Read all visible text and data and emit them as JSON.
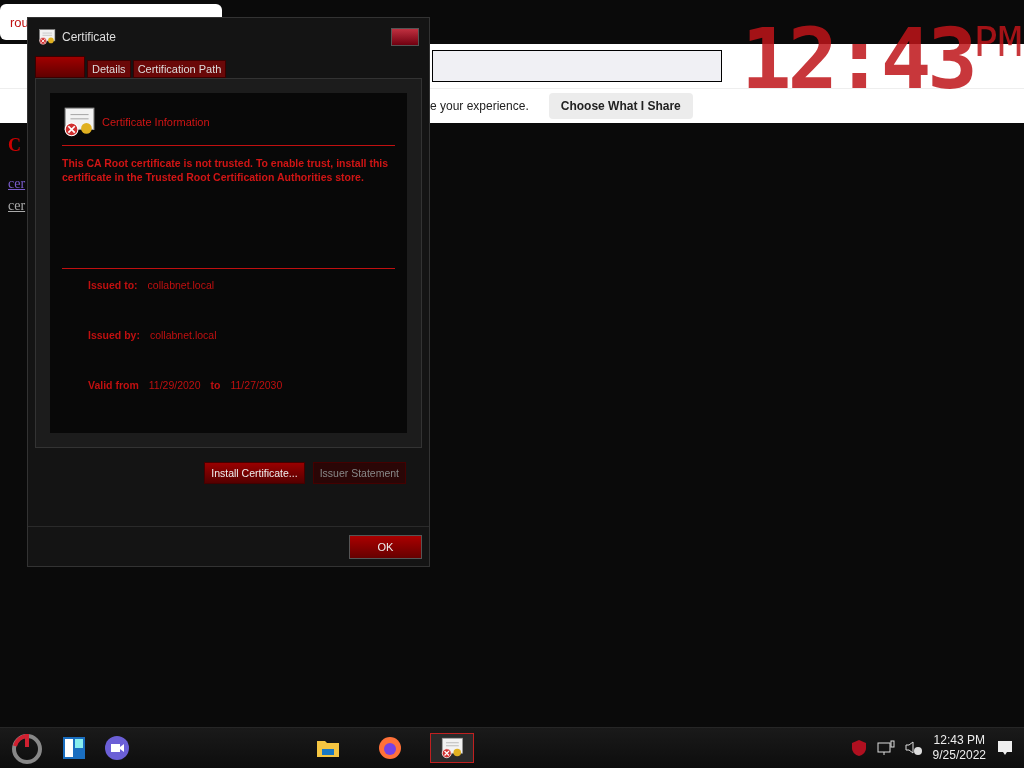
{
  "browser": {
    "tab_title": "rou",
    "notification": {
      "text": "e your experience.",
      "button": "Choose What I Share"
    },
    "page": {
      "heading": "C",
      "links": [
        {
          "label": "cer",
          "visited": true
        },
        {
          "label": "cer",
          "visited": false
        }
      ]
    }
  },
  "desktop_clock": {
    "time": "12:43",
    "suffix": "PM"
  },
  "dialog": {
    "title": "Certificate",
    "tabs": [
      {
        "selected": true
      },
      {
        "label": "Details",
        "selected": false
      },
      {
        "label": "Certification Path",
        "selected": false
      }
    ],
    "heading": "Certificate Information",
    "message": "This CA Root certificate is not trusted. To enable trust, install this certificate in the Trusted Root Certification Authorities store.",
    "fields": [
      {
        "label": "Issued to:",
        "value": "collabnet.local"
      },
      {
        "label": "Issued by:",
        "value": "collabnet.local"
      }
    ],
    "validity": {
      "label": "Valid from",
      "from": "11/29/2020",
      "joiner": "to",
      "to": "11/27/2030"
    },
    "buttons": [
      {
        "label": "Install Certificate...",
        "disabled": false
      },
      {
        "label": "Issuer Statement",
        "disabled": true
      }
    ],
    "ok": "OK"
  },
  "taskbar": {
    "apps": [
      {
        "kind": "folder",
        "selected": false
      },
      {
        "kind": "browser",
        "selected": false
      },
      {
        "kind": "certificate",
        "selected": true
      }
    ],
    "time": "12:43 PM",
    "date": "9/25/2022"
  }
}
